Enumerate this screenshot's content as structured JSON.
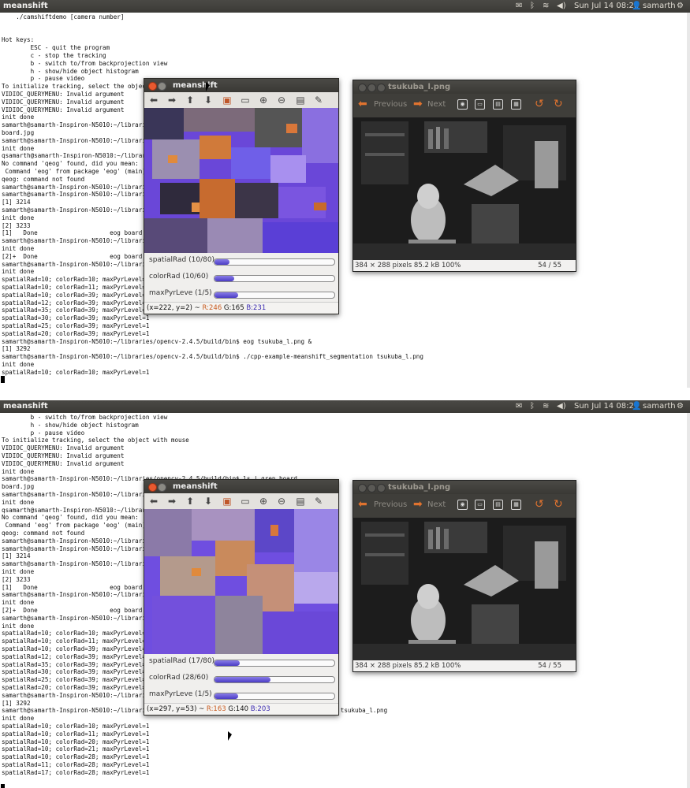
{
  "screens": [
    {
      "topbar": {
        "title": "meanshift",
        "time": "Sun Jul 14 08:26",
        "user": "samarth"
      },
      "terminal_lines": [
        "    ./camshiftdemo [camera number]",
        "",
        "",
        "Hot keys:",
        "        ESC - quit the program",
        "        c - stop the tracking",
        "        b - switch to/from backprojection view",
        "        h - show/hide object histogram",
        "        p - pause video",
        "To initialize tracking, select the object",
        "VIDIOC_QUERYMENU: Invalid argument",
        "VIDIOC_QUERYMENU: Invalid argument",
        "VIDIOC_QUERYMENU: Invalid argument",
        "init done",
        "samarth@samarth-Inspiron-N5010:~/libraries",
        "board.jpg",
        "samarth@samarth-Inspiron-N5010:~/libraries                                   board.",
        "init done",
        "qsamarth@samarth-Inspiron-N5010:~/librari",
        "No command 'qeog' found, did you mean:",
        " Command 'eog' from package 'eog' (main)",
        "qeog: command not found",
        "samarth@samarth-Inspiron-N5010:~/libraries",
        "samarth@samarth-Inspiron-N5010:~/libraries",
        "[1] 3214",
        "samarth@samarth-Inspiron-N5010:~/libraries                                   board.",
        "init done",
        "[2] 3233",
        "[1]   Done                    eog board.",
        "samarth@samarth-Inspiron-N5010:~/libraries                                   board.",
        "init done",
        "[2]+  Done                    eog board.",
        "samarth@samarth-Inspiron-N5010:~/libraries                                   entat",
        "init done",
        "spatialRad=10; colorRad=10; maxPyrLevel=1",
        "spatialRad=10; colorRad=11; maxPyrLevel=1",
        "spatialRad=10; colorRad=39; maxPyrLevel=1",
        "spatialRad=12; colorRad=39; maxPyrLevel=1",
        "spatialRad=35; colorRad=39; maxPyrLevel=1",
        "spatialRad=30; colorRad=39; maxPyrLevel=1",
        "spatialRad=25; colorRad=39; maxPyrLevel=1",
        "spatialRad=20; colorRad=39; maxPyrLevel=1",
        "samarth@samarth-Inspiron-N5010:~/libraries/opencv-2.4.5/build/bin$ eog tsukuba_l.png &",
        "[1] 3292",
        "samarth@samarth-Inspiron-N5010:~/libraries/opencv-2.4.5/build/bin$ ./cpp-example-meanshift_segmentation tsukuba_l.png",
        "init done",
        "spatialRad=10; colorRad=10; maxPyrLevel=1"
      ],
      "meanshift": {
        "title": "meanshift",
        "sliders": [
          {
            "label": "spatialRad (10/80)",
            "value": 10,
            "max": 80
          },
          {
            "label": "colorRad   (10/60)",
            "value": 10,
            "max": 60
          },
          {
            "label": "maxPyrLeve (1/5)",
            "value": 1,
            "max": 5
          }
        ],
        "status": {
          "coords": "(x=222, y=2) ~ ",
          "r": "R:246",
          "g": " G:165 ",
          "b": "B:231"
        }
      },
      "eog": {
        "title": "tsukuba_l.png",
        "previous": "Previous",
        "next": "Next",
        "info": "384 × 288 pixels  85.2 kB   100%",
        "counter": "54 / 55"
      }
    },
    {
      "topbar": {
        "title": "meanshift",
        "time": "Sun Jul 14 08:27",
        "user": "samarth"
      },
      "terminal_lines": [
        "        b - switch to/from backprojection view",
        "        h - show/hide object histogram",
        "        p - pause video",
        "To initialize tracking, select the object with mouse",
        "VIDIOC_QUERYMENU: Invalid argument",
        "VIDIOC_QUERYMENU: Invalid argument",
        "VIDIOC_QUERYMENU: Invalid argument",
        "init done",
        "samarth@samarth-Inspiron-N5010:~/libraries/opencv-2.4.5/build/bin$ ls | grep board",
        "board.jpg",
        "samarth@samarth-Inspiron-N5010:~/libraries",
        "init done",
        "qsamarth@samarth-Inspiron-N5010:~/librari",
        "No command 'qeog' found, did you mean:",
        " Command 'eog' from package 'eog' (main)",
        "qeog: command not found",
        "samarth@samarth-Inspiron-N5010:~/libraries",
        "samarth@samarth-Inspiron-N5010:~/libraries",
        "[1] 3214",
        "samarth@samarth-Inspiron-N5010:~/libraries",
        "init done",
        "[2] 3233",
        "[1]   Done                    eog board.",
        "samarth@samarth-Inspiron-N5010:~/libraries",
        "init done",
        "[2]+  Done                    eog board.",
        "samarth@samarth-Inspiron-N5010:~/libraries",
        "init done",
        "spatialRad=10; colorRad=10; maxPyrLevel=1",
        "spatialRad=10; colorRad=11; maxPyrLevel=1",
        "spatialRad=10; colorRad=39; maxPyrLevel=1",
        "spatialRad=12; colorRad=39; maxPyrLevel=1",
        "spatialRad=35; colorRad=39; maxPyrLevel=1",
        "spatialRad=30; colorRad=39; maxPyrLevel=1",
        "spatialRad=25; colorRad=39; maxPyrLevel=1",
        "spatialRad=20; colorRad=39; maxPyrLevel=1",
        "samarth@samarth-Inspiron-N5010:~/libraries",
        "[1] 3292",
        "samarth@samarth-Inspiron-N5010:~/libraries                                       segmentation tsukuba_l.png",
        "init done",
        "spatialRad=10; colorRad=10; maxPyrLevel=1",
        "spatialRad=10; colorRad=11; maxPyrLevel=1",
        "spatialRad=10; colorRad=20; maxPyrLevel=1",
        "spatialRad=10; colorRad=21; maxPyrLevel=1",
        "spatialRad=10; colorRad=28; maxPyrLevel=1",
        "spatialRad=11; colorRad=28; maxPyrLevel=1",
        "spatialRad=17; colorRad=28; maxPyrLevel=1"
      ],
      "meanshift": {
        "title": "meanshift",
        "sliders": [
          {
            "label": "spatialRad (17/80)",
            "value": 17,
            "max": 80
          },
          {
            "label": "colorRad   (28/60)",
            "value": 28,
            "max": 60
          },
          {
            "label": "maxPyrLeve (1/5)",
            "value": 1,
            "max": 5
          }
        ],
        "status": {
          "coords": "(x=297, y=53) ~ ",
          "r": "R:163",
          "g": " G:140 ",
          "b": "B:203"
        }
      },
      "eog": {
        "title": "tsukuba_l.png",
        "previous": "Previous",
        "next": "Next",
        "info": "384 × 288 pixels  85.2 kB   100%",
        "counter": "54 / 55"
      }
    }
  ],
  "icons": {
    "meanshift_toolbar": [
      "arrow-left-icon",
      "arrow-right-icon",
      "arrow-up-icon",
      "arrow-down-icon",
      "image-icon",
      "screen-icon",
      "zoom-in-icon",
      "zoom-out-icon",
      "save-icon",
      "brush-icon"
    ],
    "eog_toolbar": [
      "camera-icon",
      "folder-icon",
      "file-icon",
      "grid-icon",
      "rotate-left-icon",
      "rotate-right-icon"
    ]
  },
  "colors": {
    "accent_purple": "#5a3fd6",
    "accent_orange": "#e0732f",
    "topbar": "#3c3b37"
  }
}
